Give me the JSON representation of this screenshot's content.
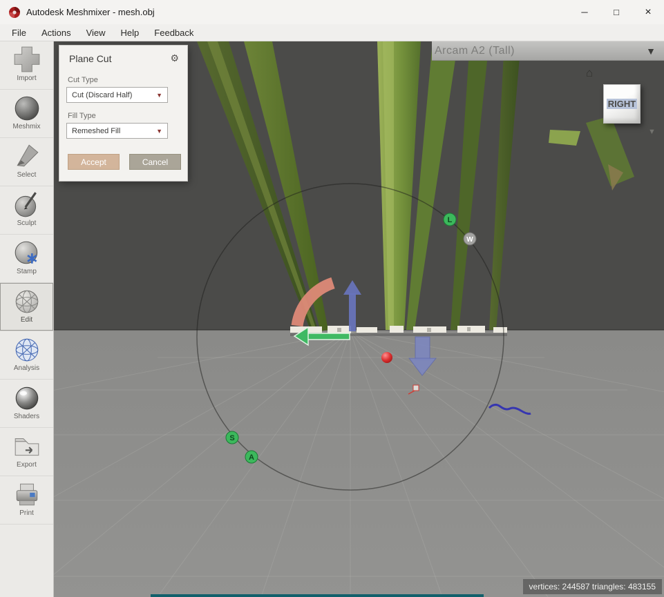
{
  "window": {
    "title": "Autodesk Meshmixer - mesh.obj"
  },
  "icons": {
    "gear": "⚙",
    "home": "⌂",
    "dropdown": "▼",
    "minimize": "─",
    "maximize": "□",
    "close": "×"
  },
  "menu": {
    "items": [
      "File",
      "Actions",
      "View",
      "Help",
      "Feedback"
    ]
  },
  "sidebar": {
    "active_tool": "Edit",
    "items": [
      {
        "label": "Import"
      },
      {
        "label": "Meshmix"
      },
      {
        "label": "Select"
      },
      {
        "label": "Sculpt"
      },
      {
        "label": "Stamp"
      },
      {
        "label": "Edit"
      },
      {
        "label": "Analysis"
      },
      {
        "label": "Shaders"
      },
      {
        "label": "Export"
      },
      {
        "label": "Print"
      }
    ]
  },
  "plane_cut": {
    "title": "Plane Cut",
    "cut_type_label": "Cut Type",
    "cut_type_value": "Cut (Discard Half)",
    "fill_type_label": "Fill Type",
    "fill_type_value": "Remeshed Fill",
    "accept": "Accept",
    "cancel": "Cancel"
  },
  "printer": {
    "value": "Arcam A2 (Tall)"
  },
  "view_cube": {
    "face": "RIGHT"
  },
  "gizmo": {
    "handles": [
      {
        "letter": "L"
      },
      {
        "letter": "W"
      },
      {
        "letter": "S"
      },
      {
        "letter": "A"
      }
    ]
  },
  "status": {
    "vertices": "244587",
    "triangles": "483155",
    "text": "vertices: 244587 triangles: 483155"
  },
  "colors": {
    "accept_button": "#d3b59b",
    "cancel_button": "#aaa598",
    "arrow_blue": "#7b86c2",
    "arrow_green": "#3fb963",
    "rotation_arc": "#e28b79",
    "handle_green": "#3cb85c",
    "pivot_red": "#d42020"
  }
}
